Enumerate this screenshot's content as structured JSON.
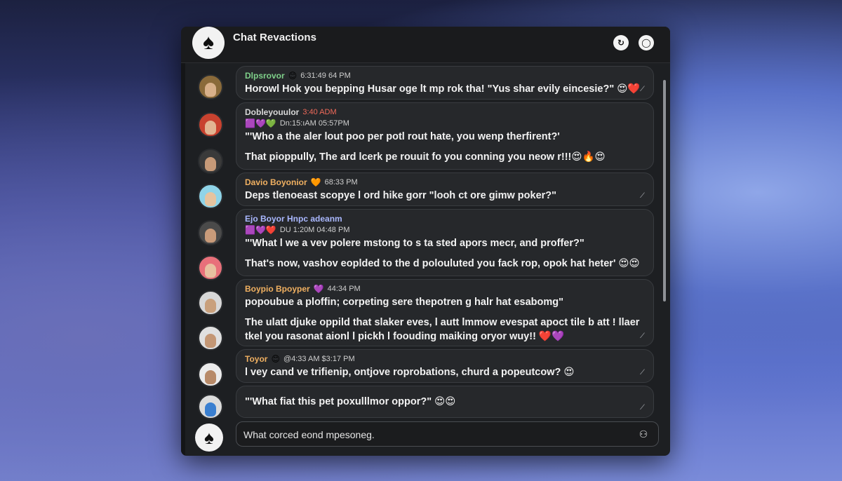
{
  "window": {
    "title": "Chat Revactions"
  },
  "header": {
    "logo_glyph": "♠",
    "button1_glyph": "↻",
    "button2_glyph": "◯"
  },
  "messages": [
    {
      "name": "Dlpsrovor",
      "name_color": "green",
      "badge": "😊",
      "time": "6:31:49 64 PM",
      "lines": [
        "Horowl Hok you bepping Husar oge lt mp rok tha! \"Yus shar evily eincesie?\" 😍❤️"
      ]
    },
    {
      "name": "Dobleyouulor",
      "name_color": "gray",
      "time": "3:40 ADM",
      "time_color": "red",
      "sub": {
        "emojis": "🟪💜💚",
        "time": "Dn:15:ıAM 05:57PM"
      },
      "lines": [
        "\"'Who a the aler lout poo per potl rout hate, you wenp therfirent?'",
        "That pioppully, The ard lcerk pe rouuit fo you conning you neow r!!!😍🔥😍"
      ]
    },
    {
      "name": "Davio Boyonior",
      "name_color": "orange",
      "badge": "🧡",
      "time": "68:33 PM",
      "lines": [
        "Deps tlenoeast scopye l ord hike gorr \"looh ct ore gimw poker?\""
      ]
    },
    {
      "name": "Ejo Boyor Hnpc adeanm",
      "name_color": "blue",
      "sub": {
        "emojis": "🟪💜❤️",
        "time": "DU 1:20M 04:48 PM"
      },
      "lines": [
        "\"'What l we a vev polere mstong to s ta sted apors mecr, and proffer?\"",
        "That's now, vashov eoplded to the d polouluted you fack rop, opok hat heter' 😍😍"
      ]
    },
    {
      "name": "Boypio Bpoyper",
      "name_color": "orange",
      "badge": "💜",
      "time": "44:34 PM",
      "lines": [
        "popoubue a ploffin; corpeting sere thepotren g halr hat esabomg\"",
        "The ulatt djuke oppild that slaker eves, l autt lmmow evespat apoct tile b att ! llaer",
        "tkel you rasonat aionl l pickh l foouding maiking oryor wuy!! ❤️💜"
      ]
    },
    {
      "name": "Toyor",
      "name_color": "orange",
      "badge": "😊",
      "time": "@4:33 AM $3:17 PM",
      "lines": [
        "l vey cand ve trifienip, ontjove roprobations, churd a popeutcow? 😍"
      ]
    },
    {
      "name": "",
      "name_color": "gray",
      "time": "",
      "lines": [
        "\"'What fiat this pet poxulllmor oppor?\" 😍😍"
      ]
    }
  ],
  "composer": {
    "value": "What corced eond mpesoneg.",
    "placeholder": "",
    "logo_glyph": "♠",
    "send_glyph": "⚇"
  },
  "colors": {
    "background_top": "#1c2140",
    "background_bottom": "#7a8bd9",
    "window_bg": "#1d1f22",
    "bubble_bg": "#26282b",
    "accent_green": "#7fd08a",
    "accent_orange": "#f0b061",
    "time_red": "#f06a5a"
  },
  "icons": {
    "logo": "spade-icon",
    "refresh": "refresh-icon",
    "circle": "circle-icon",
    "send": "send-icon"
  }
}
